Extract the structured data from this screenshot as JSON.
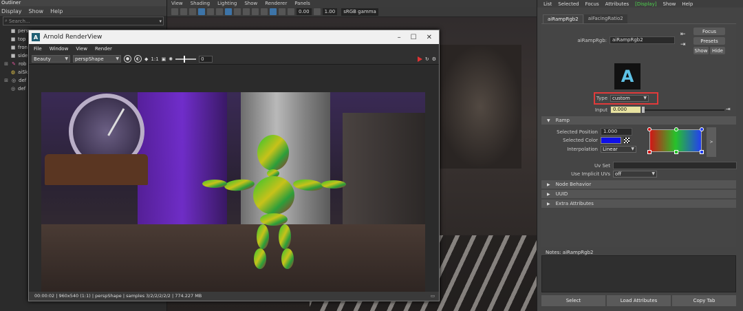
{
  "outliner": {
    "title": "Outliner",
    "menu": [
      "Display",
      "Show",
      "Help"
    ],
    "search_placeholder": "Search...",
    "items": [
      {
        "label": "pers",
        "icon": "camera-icon"
      },
      {
        "label": "top",
        "icon": "camera-icon"
      },
      {
        "label": "fron",
        "icon": "camera-icon"
      },
      {
        "label": "side",
        "icon": "camera-icon"
      },
      {
        "label": "rob",
        "icon": "mesh-icon"
      },
      {
        "label": "aiSk",
        "icon": "skydome-icon"
      },
      {
        "label": "def",
        "icon": "set-icon"
      },
      {
        "label": "def",
        "icon": "set-icon"
      }
    ]
  },
  "viewport": {
    "menu": [
      "View",
      "Shading",
      "Lighting",
      "Show",
      "Renderer",
      "Panels"
    ],
    "field1": "0.00",
    "field2": "1.00",
    "gamma": "sRGB gamma"
  },
  "renderview": {
    "title": "Arnold RenderView",
    "menu": [
      "File",
      "Window",
      "View",
      "Render"
    ],
    "aov": "Beauty",
    "camera": "perspShape",
    "ratio": "1:1",
    "exposure": "0",
    "status": "00:00:02 | 960x540 (1:1) | perspShape | samples 3/2/2/2/2/2 | 774.227 MB"
  },
  "attribute_editor": {
    "menu": [
      "List",
      "Selected",
      "Focus",
      "Attributes",
      "Display",
      "Show",
      "Help"
    ],
    "active_menu": "Display",
    "tabs": [
      "aiRampRgb2",
      "aiFacingRatio2"
    ],
    "node_label": "aiRampRgb:",
    "node_value": "aiRampRgb2",
    "buttons": {
      "focus": "Focus",
      "presets": "Presets",
      "show": "Show",
      "hide": "Hide"
    },
    "type_label": "Type",
    "type_value": "custom",
    "input_label": "Input",
    "input_value": "0.000",
    "ramp_section": "Ramp",
    "selected_position_label": "Selected Position",
    "selected_position_value": "1.000",
    "selected_color_label": "Selected Color",
    "selected_color": "#1010e8",
    "interpolation_label": "Interpolation",
    "interpolation_value": "Linear",
    "ramp_button": ">",
    "uvset_label": "Uv Set",
    "implicit_label": "Use Implicit UVs",
    "implicit_value": "off",
    "sections": [
      "Node Behavior",
      "UUID",
      "Extra Attributes"
    ],
    "notes_label": "Notes:  aiRampRgb2",
    "bottom_buttons": [
      "Select",
      "Load Attributes",
      "Copy Tab"
    ],
    "ramp_colors": {
      "left": "#d11616",
      "mid": "#27c22a",
      "right": "#2340f0",
      "highlight": "#e23a3a"
    }
  }
}
